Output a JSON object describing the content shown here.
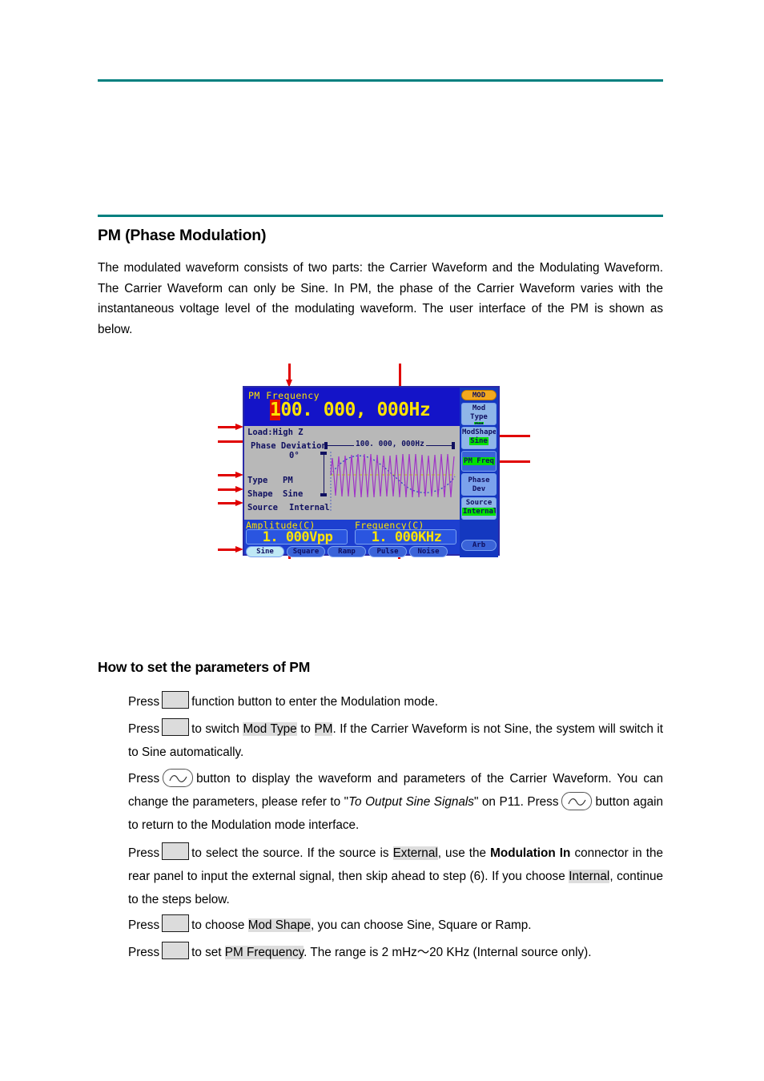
{
  "doc": {
    "heading": "PM (Phase Modulation)",
    "intro": "The modulated waveform consists of two parts: the Carrier Waveform and the Modulating Waveform. The Carrier Waveform can only be Sine. In PM, the phase of the Carrier Waveform varies with the instantaneous voltage level of the modulating waveform. The user interface of the PM is shown as below.",
    "heading2": "How to set the parameters of PM",
    "steps": {
      "s1_a": "Press",
      "s1_b": "function button to enter the Modulation mode.",
      "s2_a": "Press",
      "s2_b": "to switch",
      "s2_hl1": "Mod Type",
      "s2_c": "to",
      "s2_hl2": "PM",
      "s2_d": ". If the Carrier Waveform is not Sine, the system will switch it to Sine automatically.",
      "s3_a": "Press",
      "s3_b": "button to display the waveform and parameters of the Carrier Waveform. You can change the parameters, please refer to \"",
      "s3_italic": "To Output Sine Signals",
      "s3_c": "\" on P11. Press",
      "s3_d": "button again to return to the Modulation mode interface.",
      "s4_a": "Press",
      "s4_b": "to select the source. If the source is",
      "s4_hl1": "External",
      "s4_c": ", use the",
      "s4_bold": "Modulation In",
      "s4_d": "connector in the rear panel to input the external signal, then skip ahead to step (6). If you choose",
      "s4_hl2": "Internal",
      "s4_e": ", continue to the steps below.",
      "s5_a": "Press",
      "s5_b": "to choose",
      "s5_hl1": "Mod Shape",
      "s5_c": ", you can choose Sine, Square or Ramp.",
      "s6_a": "Press",
      "s6_b": "to set",
      "s6_hl1": "PM Frequency",
      "s6_c": ". The range is 2 mHz～20 KHz (Internal source only)."
    }
  },
  "device": {
    "header": {
      "label": "PM Frequency",
      "value_cursor": "1",
      "value_rest": "00. 000, 000Hz"
    },
    "info": {
      "load": "Load:High Z",
      "phase_dev_label": "Phase Deviation",
      "phase_dev_value": "0°",
      "type_label": "Type",
      "type_value": "PM",
      "shape_label": "Shape",
      "shape_value": "Sine",
      "source_label": "Source",
      "source_value": "Internal",
      "carrier_freq": "100. 000, 000Hz"
    },
    "menu": {
      "mod": "MOD",
      "mod_type_l1": "Mod Type",
      "mod_type_l2": "PM",
      "mod_shape_l1": "ModShape",
      "mod_shape_l2": "Sine",
      "pm_freq": "PM Freq",
      "phase_dev_l1": "Phase",
      "phase_dev_l2": "Dev",
      "source_l1": "Source",
      "source_l2": "Internal",
      "arb": "Arb"
    },
    "values": {
      "amplitude_label": "Amplitude(C)",
      "amplitude_value": "1. 000Vpp",
      "frequency_label": "Frequency(C)",
      "frequency_value": "1. 000KHz"
    },
    "tabs": [
      {
        "label": "Sine",
        "selected": true
      },
      {
        "label": "Square",
        "selected": false
      },
      {
        "label": "Ramp",
        "selected": false
      },
      {
        "label": "Pulse",
        "selected": false
      },
      {
        "label": "Noise",
        "selected": false
      }
    ]
  },
  "colors": {
    "rule": "#00807f",
    "arrow": "#e00000",
    "screen_blue": "#1438c0",
    "screen_yellow": "#ffe400",
    "highlight_green": "#00e000",
    "mod_orange": "#f2a81e"
  }
}
